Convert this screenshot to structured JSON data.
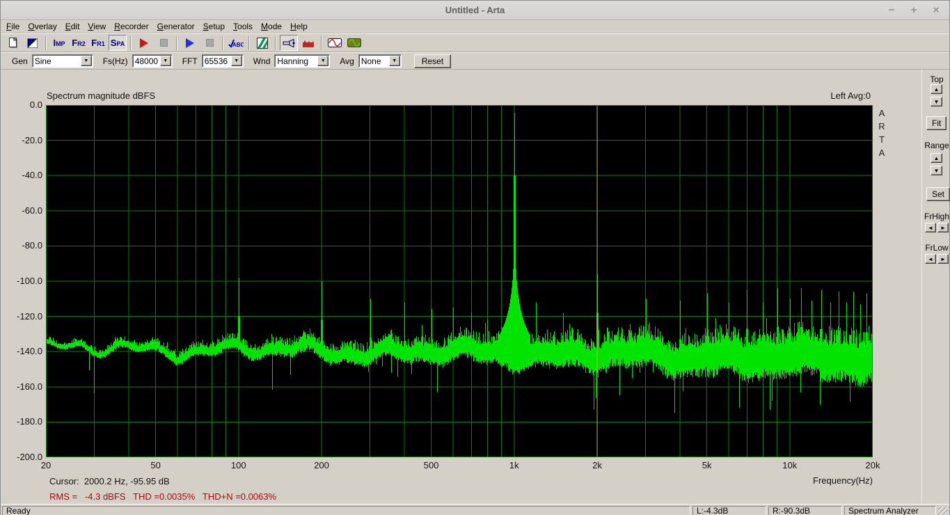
{
  "window": {
    "title": "Untitled - Arta",
    "controls": [
      {
        "name": "minimize",
        "glyph": "−"
      },
      {
        "name": "maximize",
        "glyph": "+"
      },
      {
        "name": "close",
        "glyph": "×"
      }
    ]
  },
  "menu": {
    "items": [
      {
        "label": "File"
      },
      {
        "label": "Overlay"
      },
      {
        "label": "Edit"
      },
      {
        "label": "View"
      },
      {
        "label": "Recorder"
      },
      {
        "label": "Generator"
      },
      {
        "label": "Setup"
      },
      {
        "label": "Tools"
      },
      {
        "label": "Mode"
      },
      {
        "label": "Help"
      }
    ]
  },
  "toolbar": {
    "buttons": [
      {
        "name": "new-file-button",
        "icon": "new-document-icon"
      },
      {
        "name": "scale-button",
        "icon": "blue-triangle-icon"
      },
      {
        "sep": true
      },
      {
        "name": "imp-mode-button",
        "label": "Imp"
      },
      {
        "name": "fr2-mode-button",
        "label": "Fr2"
      },
      {
        "name": "fr1-mode-button",
        "label": "Fr1"
      },
      {
        "name": "spa-mode-button",
        "label": "Spa",
        "active": true
      },
      {
        "sep": true
      },
      {
        "name": "record-run-button",
        "icon": "red-play-icon"
      },
      {
        "name": "record-stop-button",
        "icon": "stop-icon",
        "disabled": true
      },
      {
        "sep": true
      },
      {
        "name": "generator-run-button",
        "icon": "blue-play-icon"
      },
      {
        "name": "generator-stop-button",
        "icon": "stop-icon",
        "disabled": true
      },
      {
        "sep": true
      },
      {
        "name": "calibrate-button",
        "icon": "abc-check-icon"
      },
      {
        "sep": true
      },
      {
        "name": "scaling-button",
        "icon": "green-stripes-icon"
      },
      {
        "sep": true
      },
      {
        "name": "probe-button",
        "icon": "flashlight-icon",
        "active": true
      },
      {
        "name": "spectrum-view-button",
        "icon": "red-blue-mountain-icon"
      },
      {
        "sep": true
      },
      {
        "name": "sine-generator-button",
        "icon": "red-sine-icon"
      },
      {
        "name": "level-meter-button",
        "icon": "green-sine-icon"
      }
    ]
  },
  "genbar": {
    "fields": [
      {
        "name": "gen-combo",
        "label": "Gen",
        "value": "Sine",
        "width": 88
      },
      {
        "name": "fs-combo",
        "label": "Fs(Hz)",
        "value": "48000",
        "width": 58
      },
      {
        "name": "fft-combo",
        "label": "FFT",
        "value": "65536",
        "width": 60
      },
      {
        "name": "wnd-combo",
        "label": "Wnd",
        "value": "Hanning",
        "width": 80
      },
      {
        "name": "avg-combo",
        "label": "Avg",
        "value": "None",
        "width": 62
      }
    ],
    "reset_label": "Reset"
  },
  "plot": {
    "title": "Spectrum magnitude dBFS",
    "channel_info": "Left  Avg:0",
    "watermark": "ARTA",
    "xlabel": "Frequency(Hz)",
    "cursor_readout": "Cursor:  2000.2 Hz, -95.95 dB",
    "rms_readout": "RMS =   -4.3 dBFS   THD =0.0035%   THD+N =0.0063%"
  },
  "chart_data": {
    "type": "line",
    "title": "Spectrum magnitude dBFS",
    "xlabel": "Frequency(Hz)",
    "ylabel": "dBFS",
    "x_scale": "log",
    "xlim": [
      20,
      20000
    ],
    "ylim": [
      -200,
      0
    ],
    "grid": true,
    "x_ticks": [
      {
        "f": 20,
        "label": "20"
      },
      {
        "f": 50,
        "label": "50"
      },
      {
        "f": 100,
        "label": "100"
      },
      {
        "f": 200,
        "label": "200"
      },
      {
        "f": 500,
        "label": "500"
      },
      {
        "f": 1000,
        "label": "1k"
      },
      {
        "f": 2000,
        "label": "2k"
      },
      {
        "f": 5000,
        "label": "5k"
      },
      {
        "f": 10000,
        "label": "10k"
      },
      {
        "f": 20000,
        "label": "20k"
      }
    ],
    "y_ticks": [
      "0.0",
      "-20.0",
      "-40.0",
      "-60.0",
      "-80.0",
      "-100.0",
      "-120.0",
      "-140.0",
      "-160.0",
      "-180.0",
      "-200.0"
    ],
    "bg_color": "#000000",
    "grid_color": "#0c7c0c",
    "trace_color": "#00e400",
    "cursor_color": "#b9ba1d",
    "channel": "Left",
    "averages": 0,
    "fundamental": {
      "freq_hz": 1000,
      "level_dbfs": -4.3
    },
    "harmonics": [
      {
        "freq_hz": 100,
        "level_dbfs": -98
      },
      {
        "freq_hz": 200,
        "level_dbfs": -100
      },
      {
        "freq_hz": 300,
        "level_dbfs": -110
      },
      {
        "freq_hz": 400,
        "level_dbfs": -112
      },
      {
        "freq_hz": 500,
        "level_dbfs": -116
      },
      {
        "freq_hz": 600,
        "level_dbfs": -115
      },
      {
        "freq_hz": 700,
        "level_dbfs": -118
      },
      {
        "freq_hz": 800,
        "level_dbfs": -122
      },
      {
        "freq_hz": 900,
        "level_dbfs": -126
      },
      {
        "freq_hz": 1200,
        "level_dbfs": -112
      },
      {
        "freq_hz": 1500,
        "level_dbfs": -118
      },
      {
        "freq_hz": 2000,
        "level_dbfs": -95.95
      },
      {
        "freq_hz": 3000,
        "level_dbfs": -110
      },
      {
        "freq_hz": 4000,
        "level_dbfs": -111
      },
      {
        "freq_hz": 5000,
        "level_dbfs": -107
      },
      {
        "freq_hz": 6000,
        "level_dbfs": -112
      },
      {
        "freq_hz": 7000,
        "level_dbfs": -105
      },
      {
        "freq_hz": 8000,
        "level_dbfs": -112
      },
      {
        "freq_hz": 9000,
        "level_dbfs": -104
      },
      {
        "freq_hz": 10000,
        "level_dbfs": -110
      },
      {
        "freq_hz": 11000,
        "level_dbfs": -104
      },
      {
        "freq_hz": 12000,
        "level_dbfs": -111
      },
      {
        "freq_hz": 13000,
        "level_dbfs": -105
      },
      {
        "freq_hz": 14000,
        "level_dbfs": -112
      },
      {
        "freq_hz": 15000,
        "level_dbfs": -106
      },
      {
        "freq_hz": 16000,
        "level_dbfs": -112
      },
      {
        "freq_hz": 17000,
        "level_dbfs": -106
      },
      {
        "freq_hz": 18000,
        "level_dbfs": -113
      },
      {
        "freq_hz": 19000,
        "level_dbfs": -107
      },
      {
        "freq_hz": 20000,
        "level_dbfs": -113
      }
    ],
    "noise_floor_dbfs": -138,
    "noise_min_dbfs": -175,
    "cursor": {
      "freq_hz": 2000.2,
      "level_db": -95.95
    },
    "stats": {
      "rms_dbfs": -4.3,
      "thd_percent": 0.0035,
      "thdn_percent": 0.0063
    }
  },
  "side_panel": {
    "groups": [
      {
        "name": "top",
        "label": "Top",
        "type": "updown"
      },
      {
        "name": "fit",
        "label": "Fit",
        "type": "button"
      },
      {
        "name": "range",
        "label": "Range",
        "type": "updown"
      },
      {
        "name": "set",
        "label": "Set",
        "type": "button"
      },
      {
        "name": "frhigh",
        "label": "FrHigh",
        "type": "leftright"
      },
      {
        "name": "frlow",
        "label": "FrLow",
        "type": "leftright"
      }
    ]
  },
  "statusbar": {
    "left": "Ready",
    "cells": [
      "L:-4.3dB",
      "R:-90.3dB",
      "Spectrum Analyzer"
    ]
  }
}
